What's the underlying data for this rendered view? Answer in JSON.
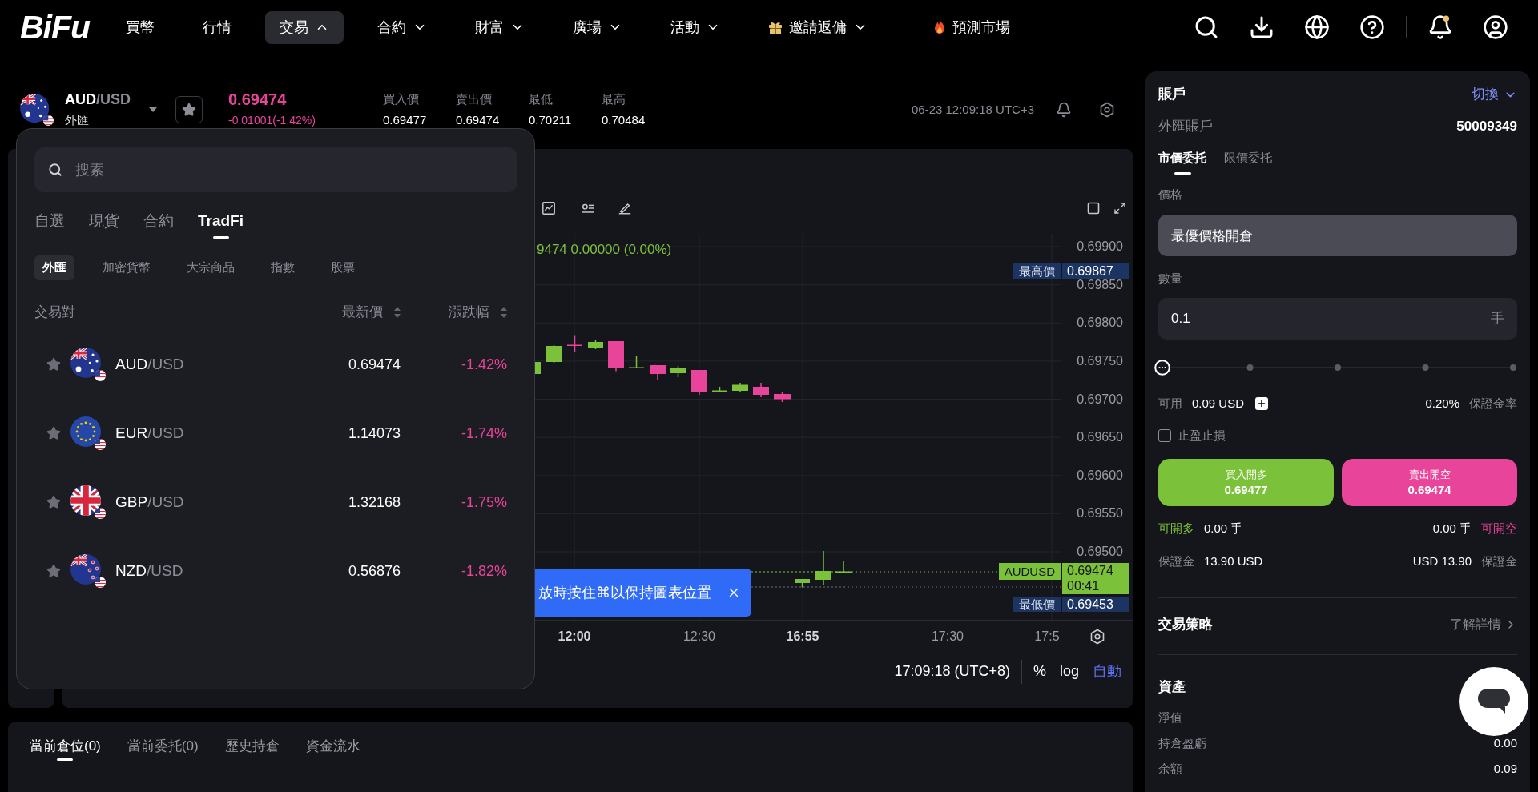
{
  "header": {
    "brand": "BiFu",
    "nav": [
      {
        "label": "買幣",
        "kind": "link",
        "selected": false
      },
      {
        "label": "行情",
        "kind": "link",
        "selected": false
      },
      {
        "label": "交易",
        "kind": "menu",
        "selected": true,
        "expanded": true
      },
      {
        "label": "合約",
        "kind": "menu",
        "selected": false,
        "expanded": false
      },
      {
        "label": "財富",
        "kind": "menu",
        "selected": false,
        "expanded": false
      },
      {
        "label": "廣場",
        "kind": "menu",
        "selected": false,
        "expanded": false
      },
      {
        "label": "活動",
        "kind": "menu",
        "selected": false,
        "expanded": false
      },
      {
        "label": "邀請返傭",
        "kind": "invite-menu",
        "selected": false,
        "expanded": false
      },
      {
        "label": "預測市場",
        "kind": "hot-link",
        "selected": false
      }
    ],
    "notifications_unread": true
  },
  "ticker": {
    "kind": "au",
    "base": "AUD",
    "quote": "/USD",
    "category": "外匯",
    "favorite": false,
    "price": "0.69474",
    "change": "-0.01001(-1.42%)",
    "negative": true,
    "stats": [
      {
        "label": "買入價",
        "value": "0.69477"
      },
      {
        "label": "賣出價",
        "value": "0.69474"
      },
      {
        "label": "最低",
        "value": "0.70211"
      },
      {
        "label": "最高",
        "value": "0.70484"
      }
    ],
    "time": "06-23 12:09:18 UTC+3"
  },
  "chart": {
    "legend": "9474 0.00000 (0.00%)",
    "price_axis": [
      "0.69900",
      "0.69850",
      "0.69800",
      "0.69750",
      "0.69700",
      "0.69650",
      "0.69600",
      "0.69550",
      "0.69500"
    ],
    "markers": [
      {
        "kind": "high",
        "label": "最高價",
        "price": "0.69867"
      },
      {
        "kind": "last",
        "label": "AUDUSD",
        "price": "0.69474",
        "countdown": "00:41"
      },
      {
        "kind": "low",
        "label": "最低價",
        "price": "0.69453"
      }
    ],
    "time_axis": [
      {
        "label": "12:00",
        "major": true
      },
      {
        "label": "12:30",
        "major": false
      },
      {
        "label": "16:55",
        "major": true
      },
      {
        "label": "17:30",
        "major": false
      },
      {
        "label": "17:5",
        "major": false
      }
    ],
    "footer": {
      "time": "17:09:18 (UTC+8)",
      "scales": [
        {
          "label": "%",
          "selected": false
        },
        {
          "label": "log",
          "selected": false
        },
        {
          "label": "自動",
          "selected": true
        }
      ]
    },
    "toast": {
      "text": "放時按住⌘以保持圖表位置"
    }
  },
  "market_picker": {
    "search": {
      "placeholder": "搜索"
    },
    "tabs": [
      {
        "label": "自選",
        "selected": false
      },
      {
        "label": "現貨",
        "selected": false
      },
      {
        "label": "合約",
        "selected": false
      },
      {
        "label": "TradFi",
        "selected": true
      }
    ],
    "categories": [
      {
        "label": "外匯",
        "selected": true
      },
      {
        "label": "加密貨幣",
        "selected": false
      },
      {
        "label": "大宗商品",
        "selected": false
      },
      {
        "label": "指數",
        "selected": false
      },
      {
        "label": "股票",
        "selected": false
      }
    ],
    "columns": [
      {
        "label": "交易對",
        "kind": "plain"
      },
      {
        "label": "最新價",
        "kind": "sortable"
      },
      {
        "label": "漲跌幅",
        "kind": "sortable"
      }
    ],
    "rows": [
      {
        "kind": "au",
        "base": "AUD",
        "quote": "/USD",
        "price": "0.69474",
        "change": "-1.42%",
        "negative": true,
        "favorite": false
      },
      {
        "kind": "eu",
        "base": "EUR",
        "quote": "/USD",
        "price": "1.14073",
        "change": "-1.74%",
        "negative": true,
        "favorite": false
      },
      {
        "kind": "gb",
        "base": "GBP",
        "quote": "/USD",
        "price": "1.32168",
        "change": "-1.75%",
        "negative": true,
        "favorite": false
      },
      {
        "kind": "nz",
        "base": "NZD",
        "quote": "/USD",
        "price": "0.56876",
        "change": "-1.82%",
        "negative": true,
        "favorite": false
      }
    ]
  },
  "order_panel": {
    "title": "賬戶",
    "switch_label": "切換",
    "account_label": "外匯賬戶",
    "account_id": "50009349",
    "order_tabs": [
      {
        "label": "市價委托",
        "selected": true
      },
      {
        "label": "限價委托",
        "selected": false
      }
    ],
    "price": {
      "label": "價格",
      "value": "最優價格開倉"
    },
    "quantity": {
      "label": "數量",
      "value": "0.1",
      "unit": "手"
    },
    "slider": {
      "level": 0
    },
    "available": {
      "label": "可用",
      "value": "0.09 USD"
    },
    "margin_rate": {
      "value": "0.20%",
      "label": "保證金率"
    },
    "tp_sl": {
      "label": "止盈止損",
      "checked": false
    },
    "buy": {
      "label": "買入開多",
      "price": "0.69477"
    },
    "sell": {
      "label": "賣出開空",
      "price": "0.69474"
    },
    "can_long": {
      "label": "可開多",
      "value": "0.00 手"
    },
    "can_short": {
      "value": "0.00 手",
      "label": "可開空"
    },
    "margin_long": {
      "label": "保證金",
      "value": "13.90 USD"
    },
    "margin_short": {
      "value": "USD 13.90",
      "label": "保證金"
    },
    "strategy": {
      "title": "交易策略",
      "link": "了解詳情"
    },
    "assets": {
      "title": "資產",
      "rows": [
        {
          "label": "淨值"
        },
        {
          "label": "持倉盈虧",
          "value": "0.00"
        },
        {
          "label": "余額",
          "value": "0.09"
        }
      ]
    }
  },
  "positions": {
    "tabs": [
      {
        "label": "當前倉位(0)",
        "selected": true
      },
      {
        "label": "當前委托(0)",
        "selected": false
      },
      {
        "label": "歷史持倉",
        "selected": false
      },
      {
        "label": "資金流水",
        "selected": false
      }
    ]
  }
}
